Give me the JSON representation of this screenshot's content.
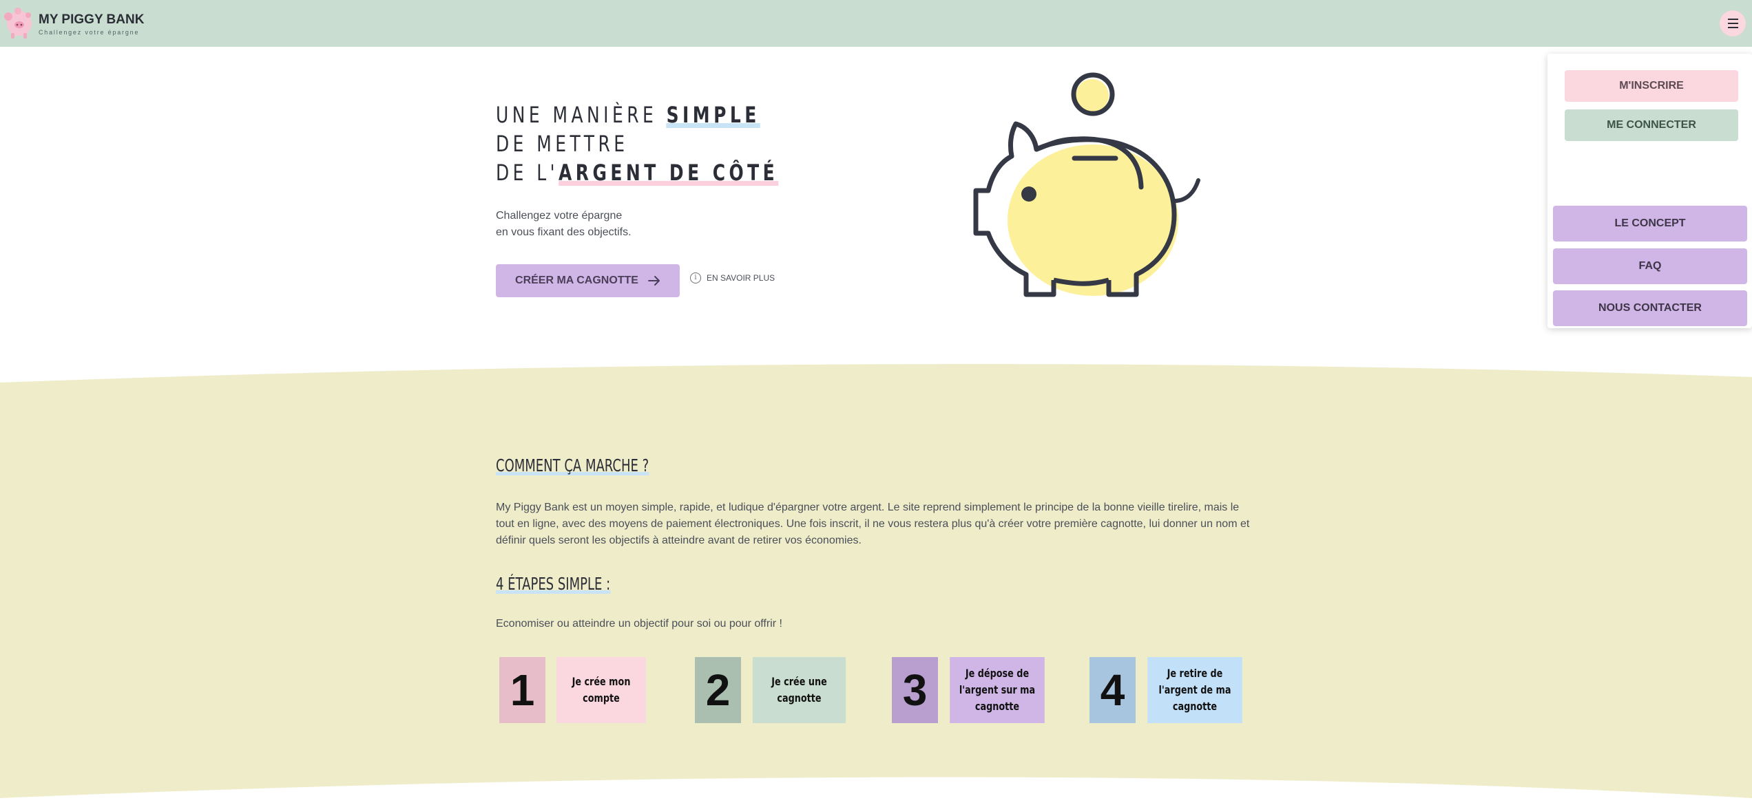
{
  "header": {
    "brand_name": "MY PIGGY BANK",
    "brand_tagline": "Challengez votre épargne"
  },
  "hero": {
    "title_line1_plain": "UNE MANIÈRE ",
    "title_line1_highlight": "SIMPLE",
    "title_line2": "DE METTRE",
    "title_line3_plain": "DE L'",
    "title_line3_highlight": "ARGENT DE CÔTÉ",
    "subtitle_line1": "Challengez votre épargne",
    "subtitle_line2": "en vous fixant des objectifs.",
    "cta_label": "CRÉER MA CAGNOTTE",
    "more_label": "EN SAVOIR PLUS"
  },
  "menu": {
    "signup": "M'INSCRIRE",
    "login": "ME CONNECTER",
    "nav": [
      "LE CONCEPT",
      "FAQ",
      "NOUS CONTACTER"
    ]
  },
  "how": {
    "title": "COMMENT ÇA MARCHE ?",
    "text": "My Piggy Bank est un moyen simple, rapide, et ludique d'épargner votre argent. Le site reprend simplement le principe de la bonne vieille tirelire, mais le tout en ligne, avec des moyens de paiement électroniques. Une fois inscrit, il ne vous restera plus qu'à créer votre première cagnotte, lui donner un nom et définir quels seront les objectifs à atteindre avant de retirer vos économies.",
    "steps_title": "4 ÉTAPES SIMPLE :",
    "steps_sub": "Economiser ou atteindre un objectif pour soi ou pour offrir !",
    "steps": [
      {
        "num": "1",
        "label": "Je crée mon compte"
      },
      {
        "num": "2",
        "label": "Je crée une cagnotte"
      },
      {
        "num": "3",
        "label": "Je dépose de l'argent sur ma cagnotte"
      },
      {
        "num": "4",
        "label": "Je retire de l'argent de ma cagnotte"
      }
    ]
  },
  "colors": {
    "header_bg": "#c9ddd0",
    "section_bg": "#efecca",
    "purple": "#cfb6e6",
    "pink": "#fbd7e0",
    "green": "#c9ddd0",
    "blue": "#c2e0f8",
    "pig_yellow": "#fdf09a"
  }
}
